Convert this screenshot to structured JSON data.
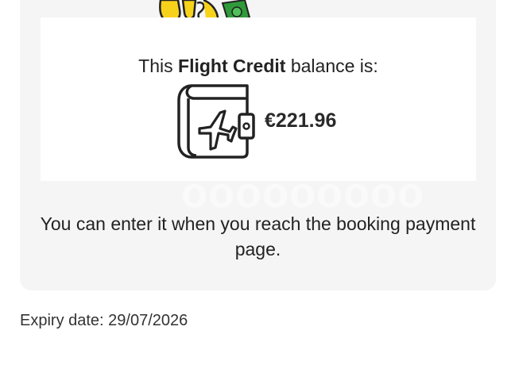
{
  "credit": {
    "prefix": "This ",
    "name": "Flight Credit",
    "suffix": " balance is:",
    "amount": "€221.96"
  },
  "info": {
    "message": "You can enter it when you reach the booking payment page."
  },
  "expiry": {
    "label": "Expiry date: 29/07/2026"
  },
  "icons": {
    "wallet": "wallet-with-airplane-icon",
    "illustration": "mascot-with-cash-illustration"
  },
  "colors": {
    "mascot_yellow": "#f7d21a",
    "cash_green": "#2f9a3a",
    "card_grey": "#f5f5f5"
  }
}
